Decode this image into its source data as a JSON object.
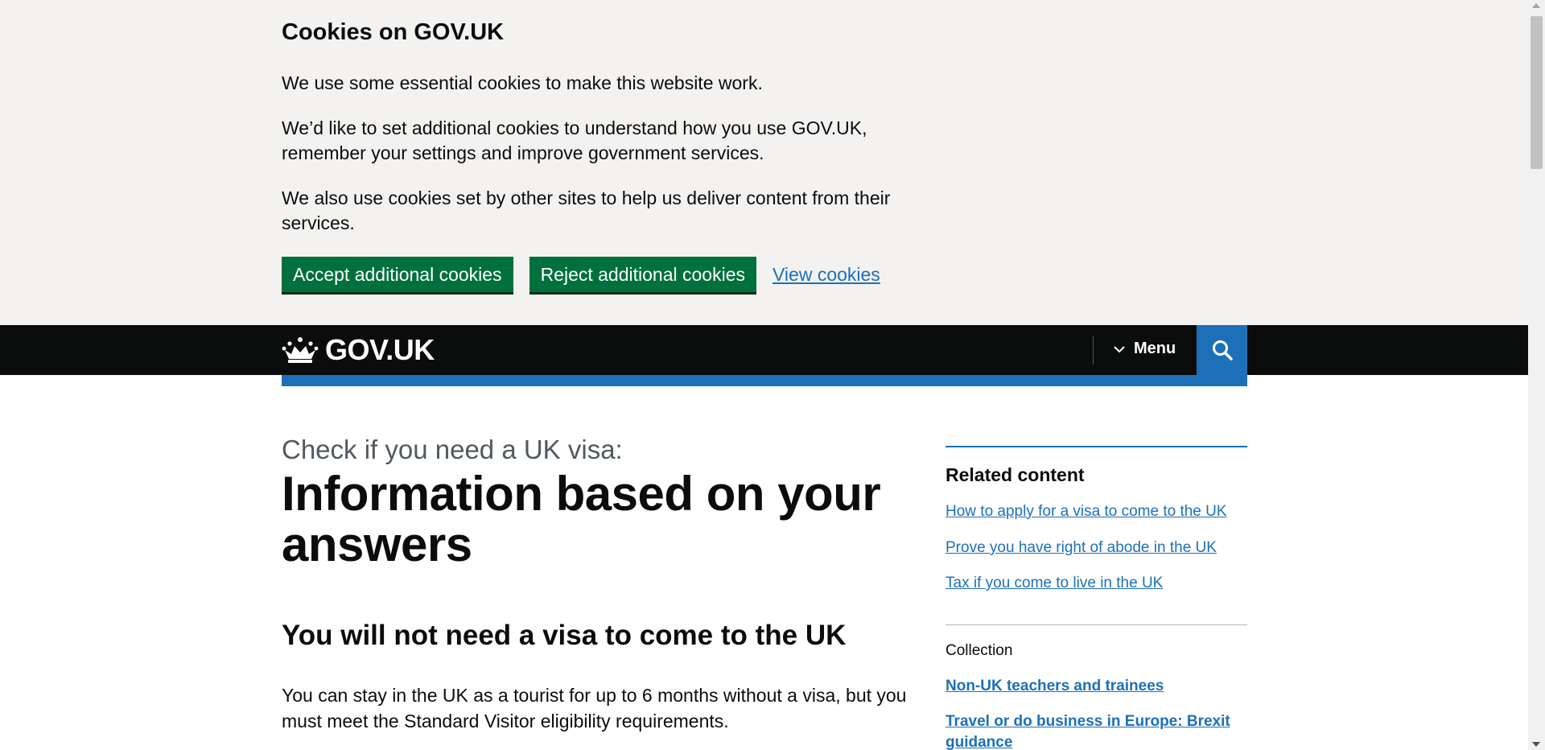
{
  "cookie_banner": {
    "title": "Cookies on GOV.UK",
    "p1": "We use some essential cookies to make this website work.",
    "p2": "We’d like to set additional cookies to understand how you use GOV.UK, remember your settings and improve government services.",
    "p3": "We also use cookies set by other sites to help us deliver content from their services.",
    "accept_label": "Accept additional cookies",
    "reject_label": "Reject additional cookies",
    "view_label": "View cookies"
  },
  "header": {
    "logo_text": "GOV.UK",
    "logo_icon": "crown-icon",
    "menu_label": "Menu",
    "menu_icon": "chevron-down-icon",
    "search_icon": "search-icon"
  },
  "main": {
    "caption": "Check if you need a UK visa:",
    "title": "Information based on your answers",
    "subheading": "You will not need a visa to come to the UK",
    "body": "You can stay in the UK as a tourist for up to 6 months without a visa, but you must meet the Standard Visitor eligibility requirements."
  },
  "sidebar": {
    "title": "Related content",
    "links": [
      "How to apply for a visa to come to the UK",
      "Prove you have right of abode in the UK",
      "Tax if you come to live in the UK"
    ],
    "collection_label": "Collection",
    "collection_links": [
      "Non-UK teachers and trainees",
      "Travel or do business in Europe: Brexit guidance"
    ]
  },
  "colors": {
    "banner_bg": "#f3f2f1",
    "header_bg": "#0b0c0c",
    "brand_blue": "#1d70b8",
    "button_green": "#00703c",
    "text": "#0b0c0c",
    "secondary_text": "#505a5f"
  }
}
